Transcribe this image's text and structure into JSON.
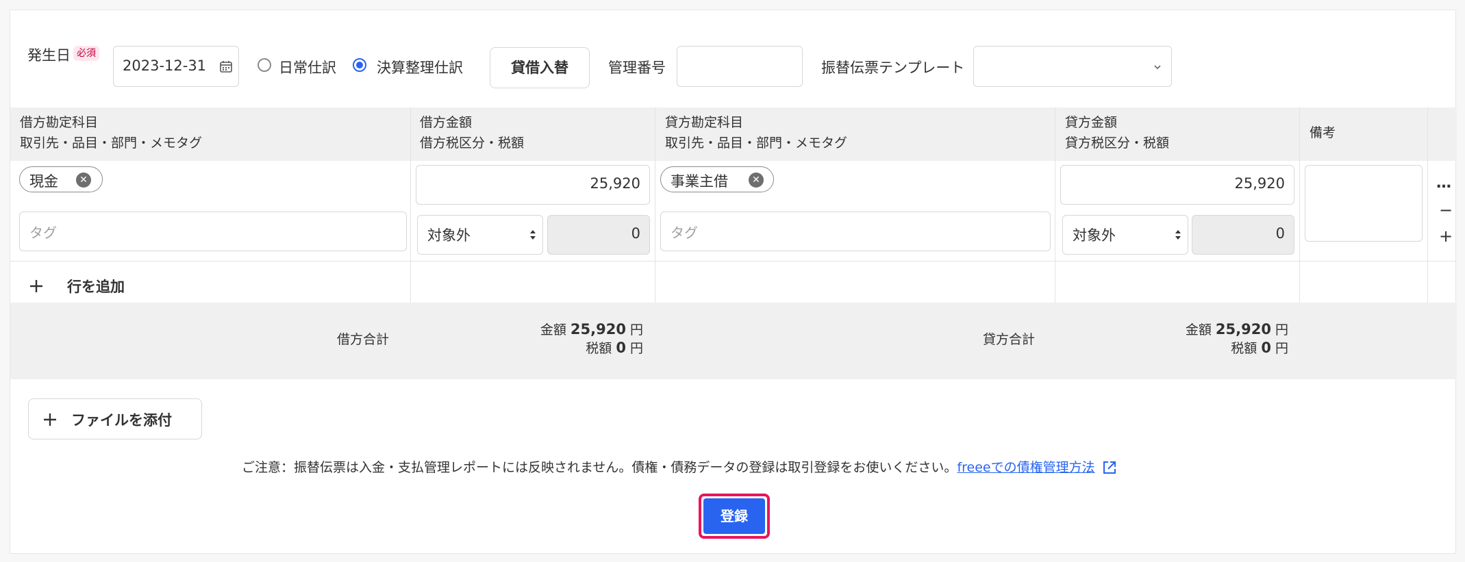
{
  "header": {
    "date_label": "発生日",
    "required_badge": "必須",
    "date_value": "2023-12-31",
    "radio_daily": "日常仕訳",
    "radio_closing": "決算整理仕訳",
    "swap_button": "貸借入替",
    "mgmt_no_label": "管理番号",
    "mgmt_no_value": "",
    "template_label": "振替伝票テンプレート",
    "template_value": ""
  },
  "columns": {
    "debit_account_1": "借方勘定科目",
    "debit_account_2": "取引先・品目・部門・メモタグ",
    "debit_amount_1": "借方金額",
    "debit_amount_2": "借方税区分・税額",
    "credit_account_1": "貸方勘定科目",
    "credit_account_2": "取引先・品目・部門・メモタグ",
    "credit_amount_1": "貸方金額",
    "credit_amount_2": "貸方税区分・税額",
    "remarks": "備考"
  },
  "row": {
    "debit_account": "現金",
    "debit_tag_placeholder": "タグ",
    "debit_amount": "25,920",
    "debit_tax_class": "対象外",
    "debit_tax": "0",
    "credit_account": "事業主借",
    "credit_tag_placeholder": "タグ",
    "credit_amount": "25,920",
    "credit_tax_class": "対象外",
    "credit_tax": "0",
    "remarks": ""
  },
  "row_actions": {
    "more": "…",
    "remove": "−",
    "add": "+"
  },
  "add_row": "行を追加",
  "totals": {
    "debit_label": "借方合計",
    "credit_label": "貸方合計",
    "amount_label": "金額",
    "tax_label": "税額",
    "yen": "円",
    "debit_amount": "25,920",
    "debit_tax": "0",
    "credit_amount": "25,920",
    "credit_tax": "0"
  },
  "attach_button": "ファイルを添付",
  "notice": "ご注意：振替伝票は入金・支払管理レポートには反映されません。債権・債務データの登録は取引登録をお使いください。",
  "notice_link": "freeeでの債権管理方法",
  "submit": "登録",
  "colors": {
    "accent": "#2864f0",
    "highlight": "#e8155b"
  }
}
